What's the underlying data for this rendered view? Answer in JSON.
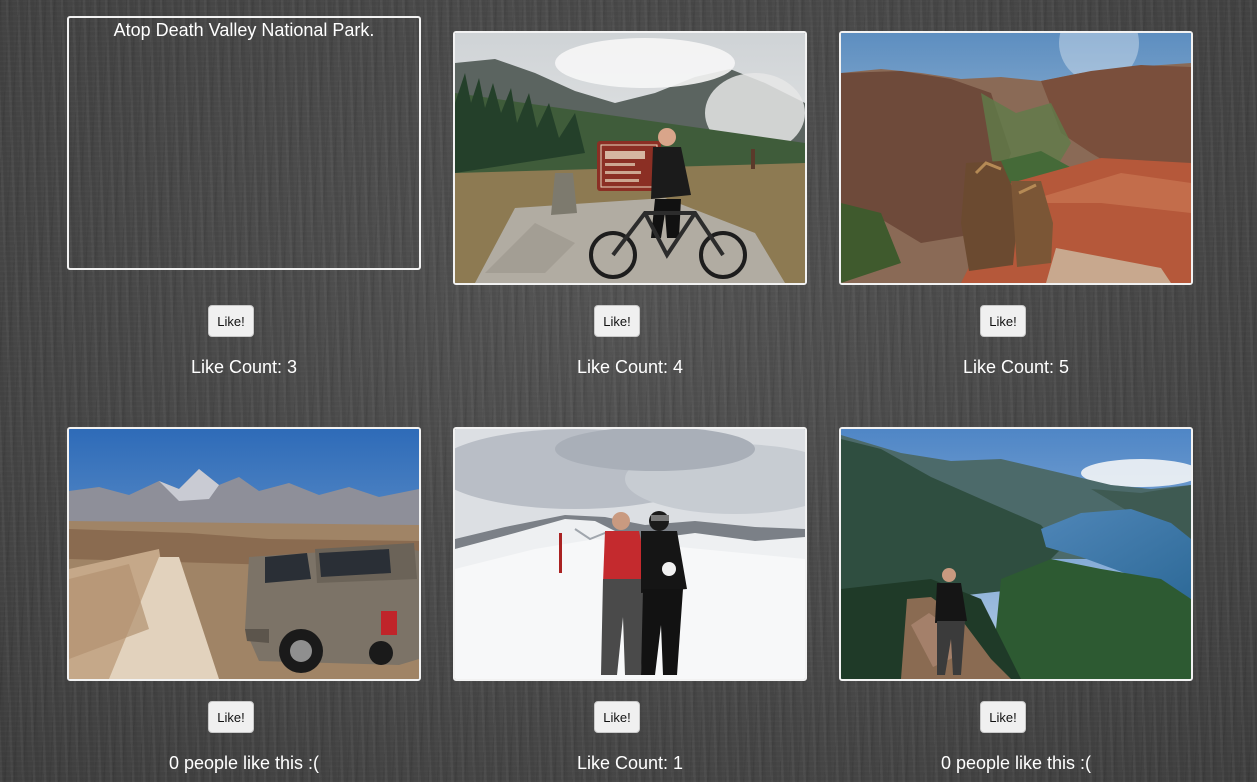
{
  "colors": {
    "background": "#474747",
    "frame_border": "#f2f2f2",
    "button_bg": "#f0f0f0",
    "text": "#ffffff"
  },
  "cards": [
    {
      "alt_text": "Atop Death Valley National Park.",
      "image_icon": "broken-image",
      "like_label": "Like!",
      "like_status": "Like Count: 3",
      "like_count": 3
    },
    {
      "image_icon": "photo-logan-pass-cyclist",
      "like_label": "Like!",
      "like_status": "Like Count: 4",
      "like_count": 4
    },
    {
      "image_icon": "photo-canyon-overlook-boots",
      "like_label": "Like!",
      "like_status": "Like Count: 5",
      "like_count": 5
    },
    {
      "image_icon": "photo-desert-road-truck",
      "like_label": "Like!",
      "like_status": "0 people like this :(",
      "like_count": 0
    },
    {
      "image_icon": "photo-snowy-summit-two-people",
      "like_label": "Like!",
      "like_status": "Like Count: 1",
      "like_count": 1
    },
    {
      "image_icon": "photo-lake-overlook-hiker",
      "like_label": "Like!",
      "like_status": "0 people like this :(",
      "like_count": 0
    }
  ]
}
